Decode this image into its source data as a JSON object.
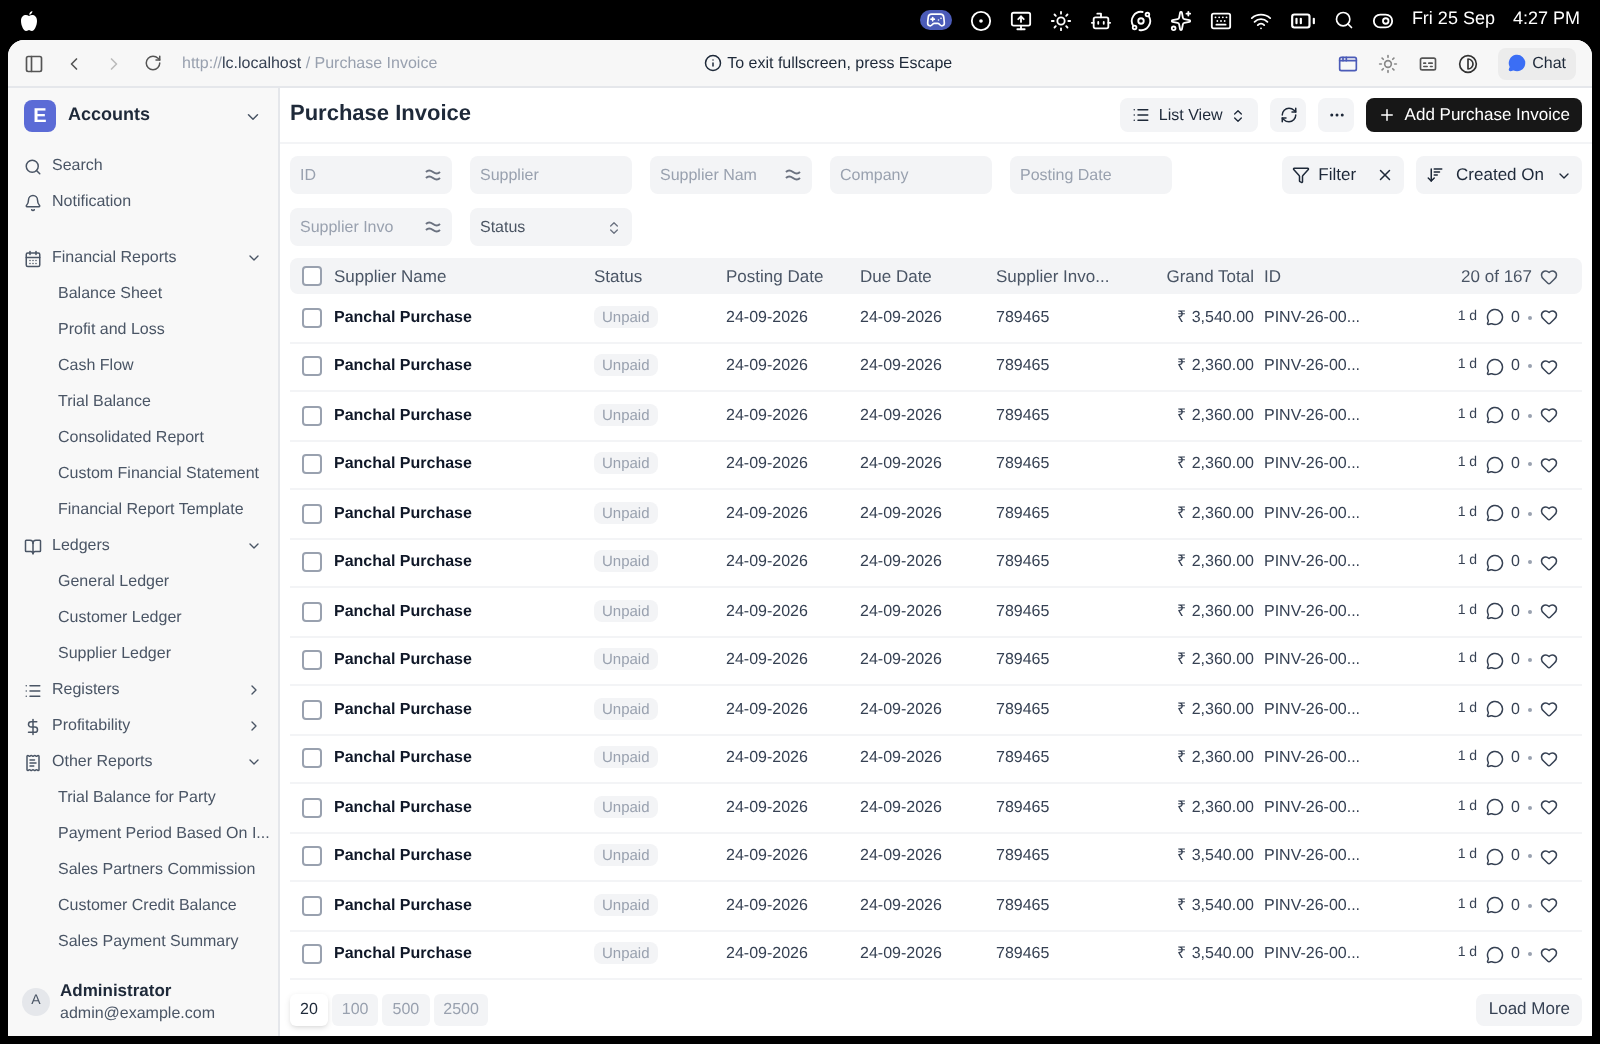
{
  "menu_bar": {
    "date": "Fri 25 Sep",
    "time": "4:27 PM"
  },
  "browser": {
    "url_scheme": "http://",
    "url_host": "lc.localhost",
    "url_path": "/ Purchase Invoice",
    "notice": "To exit fullscreen, press Escape",
    "chat": "Chat"
  },
  "sidebar": {
    "app": "Accounts",
    "app_initial": "E",
    "top_items": [
      {
        "label": "Search",
        "kind": "search"
      },
      {
        "label": "Notification",
        "kind": "bell"
      }
    ],
    "sections": [
      {
        "label": "Financial Reports",
        "kind": "calendar",
        "expanded": true,
        "children": [
          "Balance Sheet",
          "Profit and Loss",
          "Cash Flow",
          "Trial Balance",
          "Consolidated Report",
          "Custom Financial Statement",
          "Financial Report Template"
        ]
      },
      {
        "label": "Ledgers",
        "kind": "book",
        "expanded": true,
        "children": [
          "General Ledger",
          "Customer Ledger",
          "Supplier Ledger"
        ]
      },
      {
        "label": "Registers",
        "kind": "list",
        "expanded": false
      },
      {
        "label": "Profitability",
        "kind": "dollar",
        "expanded": false
      },
      {
        "label": "Other Reports",
        "kind": "receipt",
        "expanded": true,
        "children": [
          "Trial Balance for Party",
          "Payment Period Based On I...",
          "Sales Partners Commission",
          "Customer Credit Balance",
          "Sales Payment Summary"
        ]
      }
    ],
    "user": {
      "initial": "A",
      "name": "Administrator",
      "email": "admin@example.com"
    }
  },
  "page": {
    "title": "Purchase Invoice",
    "view": "List View",
    "add_button": "Add Purchase Invoice"
  },
  "filters": [
    {
      "placeholder": "ID",
      "kind": "operator"
    },
    {
      "placeholder": "Supplier",
      "kind": "text"
    },
    {
      "placeholder": "Supplier Nam",
      "kind": "operator"
    },
    {
      "placeholder": "Company",
      "kind": "text"
    },
    {
      "placeholder": "Posting Date",
      "kind": "text"
    },
    {
      "placeholder": "Supplier Invo",
      "kind": "operator"
    },
    {
      "placeholder": "Status",
      "kind": "select"
    }
  ],
  "filter_button": "Filter",
  "sort_button": "Created On",
  "table": {
    "select_all_checked": false,
    "columns": [
      "Supplier Name",
      "Status",
      "Posting Date",
      "Due Date",
      "Supplier Invo...",
      "Grand Total",
      "ID"
    ],
    "count": "20 of 167",
    "rows": [
      {
        "checked": false,
        "supplier": "Panchal Purchase",
        "status": "Unpaid",
        "posting_date": "24-09-2026",
        "due_date": "24-09-2026",
        "supplier_invoice": "789465",
        "grand_total": "₹ 3,540.00",
        "id": "PINV-26-00...",
        "age": "1 d",
        "comments": "0"
      },
      {
        "checked": false,
        "supplier": "Panchal Purchase",
        "status": "Unpaid",
        "posting_date": "24-09-2026",
        "due_date": "24-09-2026",
        "supplier_invoice": "789465",
        "grand_total": "₹ 2,360.00",
        "id": "PINV-26-00...",
        "age": "1 d",
        "comments": "0"
      },
      {
        "checked": false,
        "supplier": "Panchal Purchase",
        "status": "Unpaid",
        "posting_date": "24-09-2026",
        "due_date": "24-09-2026",
        "supplier_invoice": "789465",
        "grand_total": "₹ 2,360.00",
        "id": "PINV-26-00...",
        "age": "1 d",
        "comments": "0"
      },
      {
        "checked": false,
        "supplier": "Panchal Purchase",
        "status": "Unpaid",
        "posting_date": "24-09-2026",
        "due_date": "24-09-2026",
        "supplier_invoice": "789465",
        "grand_total": "₹ 2,360.00",
        "id": "PINV-26-00...",
        "age": "1 d",
        "comments": "0"
      },
      {
        "checked": false,
        "supplier": "Panchal Purchase",
        "status": "Unpaid",
        "posting_date": "24-09-2026",
        "due_date": "24-09-2026",
        "supplier_invoice": "789465",
        "grand_total": "₹ 2,360.00",
        "id": "PINV-26-00...",
        "age": "1 d",
        "comments": "0"
      },
      {
        "checked": false,
        "supplier": "Panchal Purchase",
        "status": "Unpaid",
        "posting_date": "24-09-2026",
        "due_date": "24-09-2026",
        "supplier_invoice": "789465",
        "grand_total": "₹ 2,360.00",
        "id": "PINV-26-00...",
        "age": "1 d",
        "comments": "0"
      },
      {
        "checked": false,
        "supplier": "Panchal Purchase",
        "status": "Unpaid",
        "posting_date": "24-09-2026",
        "due_date": "24-09-2026",
        "supplier_invoice": "789465",
        "grand_total": "₹ 2,360.00",
        "id": "PINV-26-00...",
        "age": "1 d",
        "comments": "0"
      },
      {
        "checked": false,
        "supplier": "Panchal Purchase",
        "status": "Unpaid",
        "posting_date": "24-09-2026",
        "due_date": "24-09-2026",
        "supplier_invoice": "789465",
        "grand_total": "₹ 2,360.00",
        "id": "PINV-26-00...",
        "age": "1 d",
        "comments": "0"
      },
      {
        "checked": false,
        "supplier": "Panchal Purchase",
        "status": "Unpaid",
        "posting_date": "24-09-2026",
        "due_date": "24-09-2026",
        "supplier_invoice": "789465",
        "grand_total": "₹ 2,360.00",
        "id": "PINV-26-00...",
        "age": "1 d",
        "comments": "0"
      },
      {
        "checked": false,
        "supplier": "Panchal Purchase",
        "status": "Unpaid",
        "posting_date": "24-09-2026",
        "due_date": "24-09-2026",
        "supplier_invoice": "789465",
        "grand_total": "₹ 2,360.00",
        "id": "PINV-26-00...",
        "age": "1 d",
        "comments": "0"
      },
      {
        "checked": false,
        "supplier": "Panchal Purchase",
        "status": "Unpaid",
        "posting_date": "24-09-2026",
        "due_date": "24-09-2026",
        "supplier_invoice": "789465",
        "grand_total": "₹ 2,360.00",
        "id": "PINV-26-00...",
        "age": "1 d",
        "comments": "0"
      },
      {
        "checked": false,
        "supplier": "Panchal Purchase",
        "status": "Unpaid",
        "posting_date": "24-09-2026",
        "due_date": "24-09-2026",
        "supplier_invoice": "789465",
        "grand_total": "₹ 3,540.00",
        "id": "PINV-26-00...",
        "age": "1 d",
        "comments": "0"
      },
      {
        "checked": false,
        "supplier": "Panchal Purchase",
        "status": "Unpaid",
        "posting_date": "24-09-2026",
        "due_date": "24-09-2026",
        "supplier_invoice": "789465",
        "grand_total": "₹ 3,540.00",
        "id": "PINV-26-00...",
        "age": "1 d",
        "comments": "0"
      },
      {
        "checked": false,
        "supplier": "Panchal Purchase",
        "status": "Unpaid",
        "posting_date": "24-09-2026",
        "due_date": "24-09-2026",
        "supplier_invoice": "789465",
        "grand_total": "₹ 3,540.00",
        "id": "PINV-26-00...",
        "age": "1 d",
        "comments": "0"
      }
    ]
  },
  "page_sizes": [
    {
      "label": "20",
      "selected": true
    },
    {
      "label": "100",
      "selected": false
    },
    {
      "label": "500",
      "selected": false
    },
    {
      "label": "2500",
      "selected": false
    }
  ],
  "load_more": "Load More"
}
